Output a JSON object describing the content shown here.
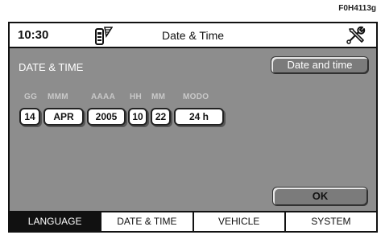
{
  "figure_code": "F0H4113g",
  "header": {
    "time": "10:30",
    "title": "Date & Time",
    "phone_icon": "phone-signal-icon",
    "tools_icon": "tools-icon"
  },
  "section_title": "DATE & TIME",
  "buttons": {
    "date_and_time": "Date and time",
    "ok": "OK"
  },
  "fields": {
    "labels": [
      "GG",
      "MMM",
      "AAAA",
      "HH",
      "MM",
      "MODO"
    ],
    "values": [
      "14",
      "APR",
      "2005",
      "10",
      "22",
      "24 h"
    ]
  },
  "tabs": [
    {
      "label": "LANGUAGE",
      "active": true
    },
    {
      "label": "DATE & TIME",
      "active": false
    },
    {
      "label": "VEHICLE",
      "active": false
    },
    {
      "label": "SYSTEM",
      "active": false
    }
  ],
  "colors": {
    "screen_bg": "#8d8d8d",
    "active_tab": "#111111"
  }
}
